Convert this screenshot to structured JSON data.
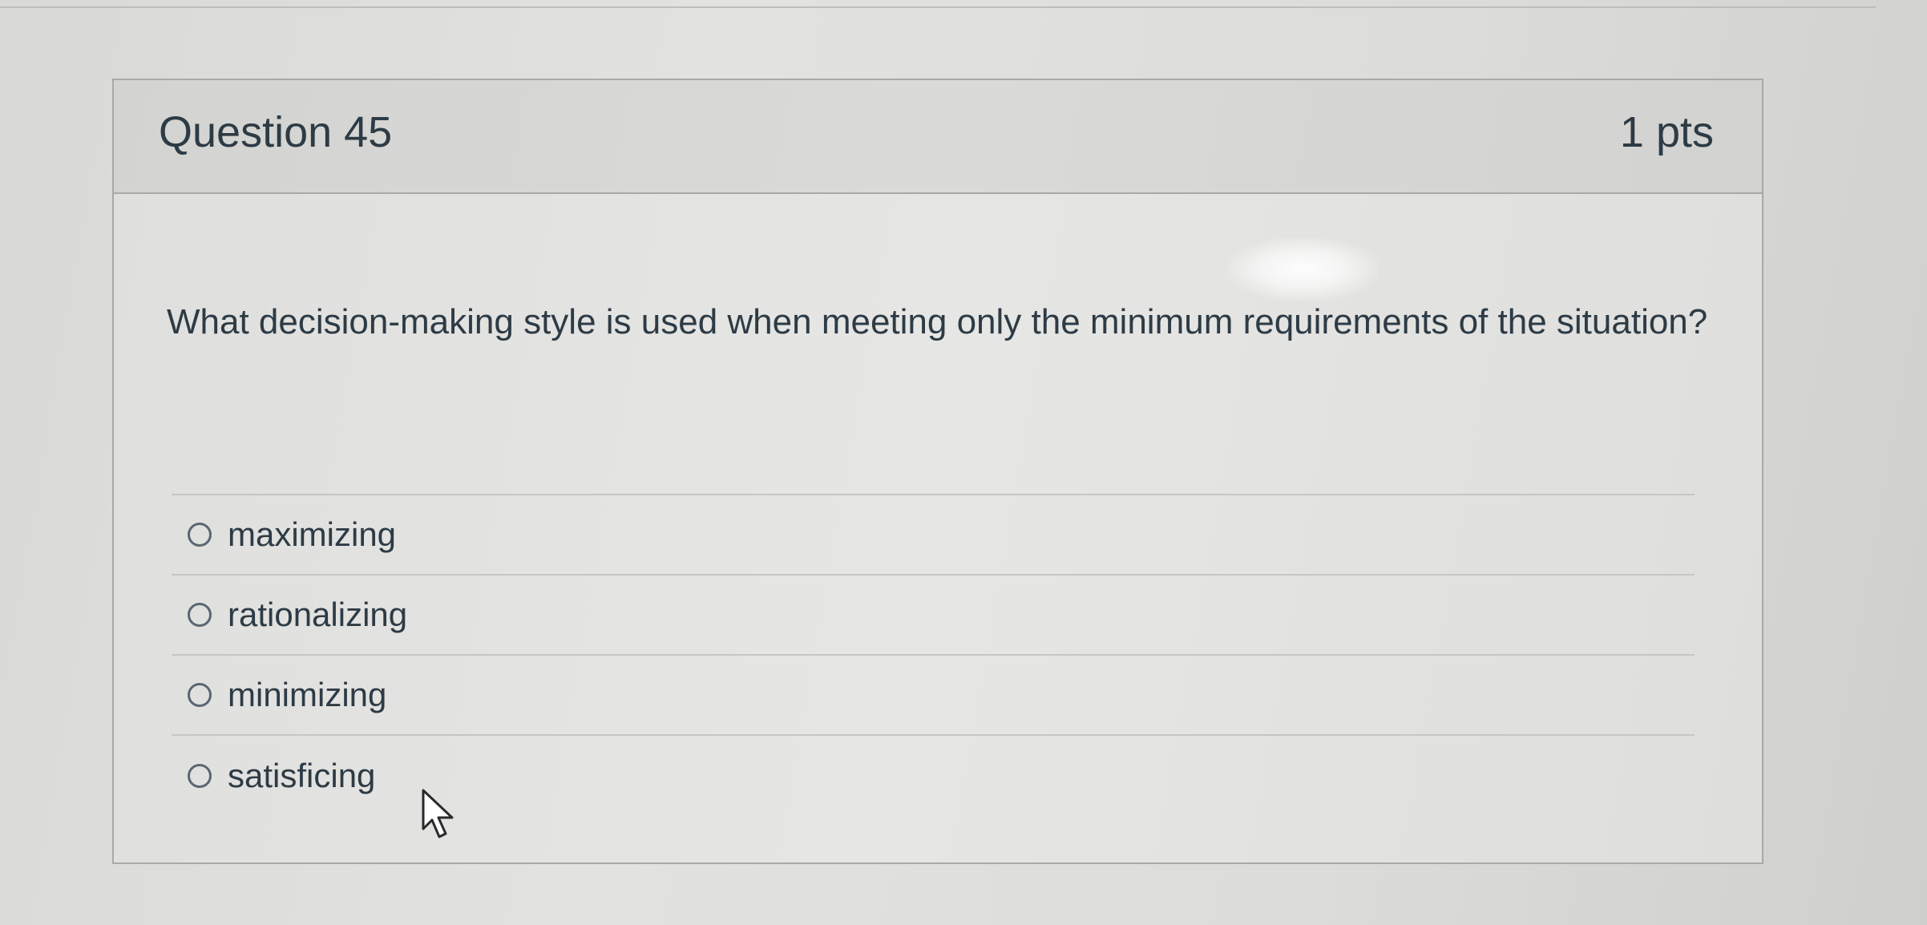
{
  "question": {
    "title": "Question 45",
    "points": "1 pts",
    "text": "What decision-making style is used when meeting only the minimum requirements of the situation?"
  },
  "answers": [
    {
      "label": "maximizing",
      "selected": false
    },
    {
      "label": "rationalizing",
      "selected": false
    },
    {
      "label": "minimizing",
      "selected": false
    },
    {
      "label": "satisficing",
      "selected": false
    }
  ],
  "colors": {
    "text": "#2d3b45",
    "border": "#a9a9a7",
    "header_bg": "#d6d6d4"
  }
}
